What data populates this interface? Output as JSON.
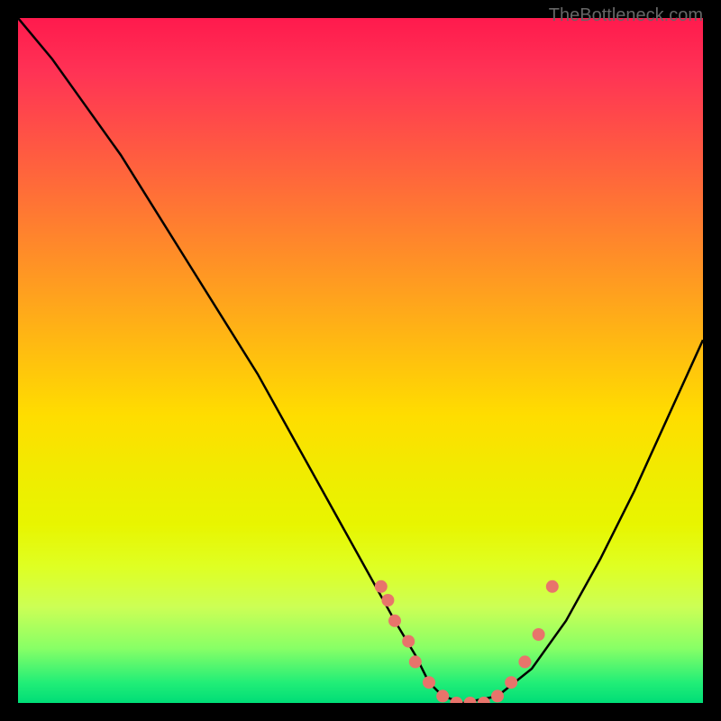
{
  "watermark": "TheBottleneck.com",
  "chart_data": {
    "type": "line",
    "title": "",
    "xlabel": "",
    "ylabel": "",
    "xlim": [
      0,
      100
    ],
    "ylim": [
      0,
      100
    ],
    "curve": {
      "description": "V-shaped bottleneck curve",
      "x": [
        0,
        5,
        10,
        15,
        20,
        25,
        30,
        35,
        40,
        45,
        50,
        55,
        58,
        60,
        62,
        65,
        70,
        75,
        80,
        85,
        90,
        95,
        100
      ],
      "y": [
        100,
        94,
        87,
        80,
        72,
        64,
        56,
        48,
        39,
        30,
        21,
        12,
        7,
        3,
        1,
        0,
        1,
        5,
        12,
        21,
        31,
        42,
        53
      ]
    },
    "scatter_points": {
      "color": "#e8746b",
      "x": [
        53,
        54,
        55,
        57,
        58,
        60,
        62,
        64,
        66,
        68,
        70,
        72,
        74,
        76,
        78
      ],
      "y": [
        17,
        15,
        12,
        9,
        6,
        3,
        1,
        0,
        0,
        0,
        1,
        3,
        6,
        10,
        17
      ]
    }
  }
}
